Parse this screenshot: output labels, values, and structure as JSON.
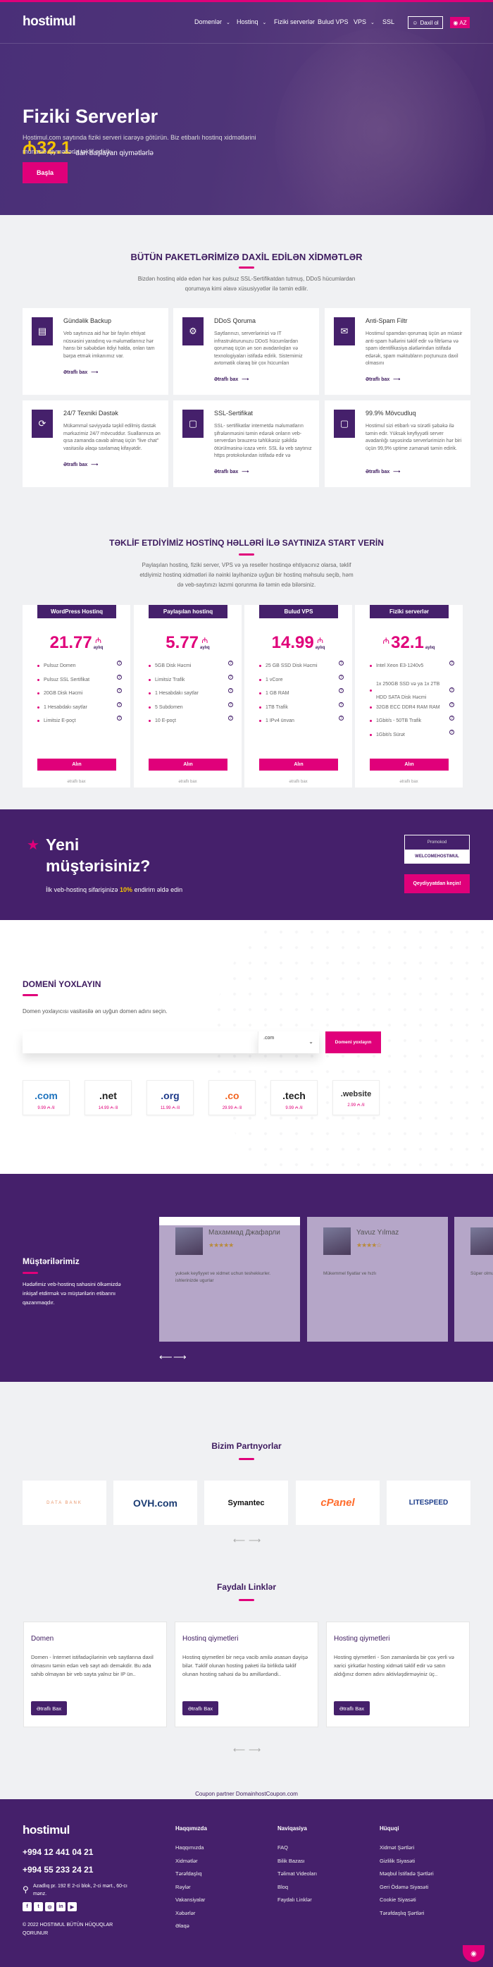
{
  "colors": {
    "purple": "#45206b",
    "pink": "#e0007a",
    "yellow": "#f5c400",
    "title": "#3d1a5e",
    "bg": "#f0f1f3"
  },
  "header": {
    "logo": "hostimul",
    "nav": [
      {
        "label": "Domenlər",
        "dropdown": true
      },
      {
        "label": "Hostinq",
        "dropdown": true
      },
      {
        "label": "Fiziki serverlər",
        "dropdown": false
      },
      {
        "label": "Bulud VPS",
        "dropdown": false
      },
      {
        "label": "VPS",
        "dropdown": true
      },
      {
        "label": "SSL",
        "dropdown": false
      }
    ],
    "login_label": "Daxil ol",
    "lang_label": "AZ"
  },
  "hero": {
    "title": "Fiziki Serverlər",
    "currency": "₼",
    "price": "32.1",
    "price_suffix": "-dan başlayan qiymətlərlə",
    "description": "Hostimul.com saytında fiziki serveri icarəyə götürün. Biz etibarlı hostinq xidmətlərini münasib qiymətlərlə təklif edirik.",
    "cta": "Başla"
  },
  "features": {
    "title": "BÜTÜN PAKETLƏRİMİZƏ DAXİL EDİLƏN XİDMƏTLƏR",
    "subtitle": "Bizdən hostinq əldə edən hər kəs pulsuz SSL-Sertifikatdan tutmuş, DDoS hücumlardan qorumaya kimi əlavə xüsusiyyətlər ilə təmin edilir.",
    "link_label": "Ətraflı bax",
    "items": [
      {
        "icon": "backup-icon",
        "title": "Gündəlik Backup",
        "text": "Veb saytınıza aid hər bir faylın ehtiyat nüsxəsini yaradırıq və məlumatlarınız hər hansı bir səbəbdən itdiyi halda, onları tam bərpa etmək imkanımız var."
      },
      {
        "icon": "ddos-shield-icon",
        "title": "DDoS Qoruma",
        "text": "Saytlarınızı, serverlərinizi və IT infrastrukturunuzu DDoS hücumlardan qorumaq üçün ən son avadanlıqları və texnologiyaları istifadə edirik. Sistemimiz avtomatik olaraq bir çox hücumları"
      },
      {
        "icon": "spam-mail-icon",
        "title": "Anti-Spam Filtr",
        "text": "Hostimul spamdan qorumaq üçün ən müasir anti-spam həllərini təklif edir və filtrləmə və spam identifikasiya alətlərindən istifadə edərək, spam məktubların poçtunuza daxil olmasını"
      },
      {
        "icon": "support-24-icon",
        "title": "24/7 Texniki Dəstək",
        "text": "Mükəmməl səviyyədə təşkil edilmiş dəstək mərkəzimiz 24/7 mövcuddur. Suallarınıza ən qısa zamanda cavab almaq üçün \"live chat\" vasitəsilə əlaqə saxlamaq kifayətdir."
      },
      {
        "icon": "ssl-icon",
        "title": "SSL-Sertifikat",
        "text": "SSL- sertifikatlar internetdə məlumatların şifrələnməsini təmin edərək onların veb-serverdən brauzerə təhlükəsiz şəkildə ötürülməsinə icazə verir. SSL ilə veb saytınız https protokolundan istifadə edir və"
      },
      {
        "icon": "uptime-icon",
        "title": "99.9% Mövcudluq",
        "text": "Hostimul sizi etibarlı və sürətli şəbəkə ilə təmin edir. Yüksək keyfiyyətli server avadanlığı sayəsində serverlərimizin hər biri üçün 99,9% uptime zəmanəti təmin edirik."
      }
    ]
  },
  "pricing": {
    "title": "TƏKLİF ETDİYİMİZ HOSTİNQ HƏLLƏRİ İLƏ SAYTINIZA START VERİN",
    "subtitle": "Paylaşılan hostinq, fiziki server, VPS və ya reseller hostinqə ehtiyacınız olarsa, təklif etdiyimiz hostinq xidmətləri ilə nəinki layihənizə uyğun bir hostinq məhsulu seçib, həm də veb-saytınızı lazımi qorunma ilə təmin edə bilərsiniz.",
    "currency": "₼",
    "period": "aylıq",
    "buy_label": "Alın",
    "more_label": "ətraflı bax",
    "plans": [
      {
        "name": "WordPress Hostinq",
        "price": "21.77",
        "features": [
          "Pulsuz Domen",
          "Pulsuz SSL Sertifikat",
          "20GB Disk Həcmi",
          "1 Hesabdakı saytlar",
          "Limitsiz E-poçt"
        ]
      },
      {
        "name": "Paylaşılan hostinq",
        "price": "5.77",
        "features": [
          "5GB Disk Həcmi",
          "Limitsiz Trafik",
          "1 Hesabdakı saytlar",
          "5 Subdomen",
          "10 E-poçt"
        ]
      },
      {
        "name": "Bulud VPS",
        "price": "14.99",
        "features": [
          "25 GB SSD Disk Həcmi",
          "1 vCore",
          "1 GB RAM",
          "1TB Trafik",
          "1 IPv4 ünvan"
        ]
      },
      {
        "name": "Fiziki serverlər",
        "price": "32.1",
        "features": [
          "Intel Xeon E3-1240v5",
          "1x 250GB SSD və ya 1x 2TB HDD SATA Disk Həcmi",
          "32GB ECC DDR4 RAM RAM",
          "1Gbit/s - 50TB Trafik",
          "1Gbit/s Sürət"
        ]
      }
    ]
  },
  "promo": {
    "title_line1": "Yeni",
    "title_line2": "müştərisiniz?",
    "text_before": "İlk veb-hostinq sifarişinizə ",
    "discount": "10%",
    "text_after": " endirim əldə edin",
    "code_label": "Promokod",
    "code": "WELCOMEHOSTIMUL",
    "cta": "Qeydiyyatdan keçin!"
  },
  "domain": {
    "title": "DOMENİ YOXLAYIN",
    "description": "Domen yoxlayıcısı vasitəsilə ən uyğun domen adını seçin.",
    "input_value": "",
    "input_placeholder": "",
    "selected_tld": ".com",
    "button": "Domeni yoxlayın",
    "tlds": [
      {
        "name": ".com",
        "price": "9.99 ₼ /il",
        "color": "#1e73be"
      },
      {
        "name": ".net",
        "price": "14.99 ₼ /il",
        "color": "#222222"
      },
      {
        "name": ".org",
        "price": "11.99 ₼ /il",
        "color": "#1e3a8a"
      },
      {
        "name": ".co",
        "price": "29.99 ₼ /il",
        "color": "#f26522"
      },
      {
        "name": ".tech",
        "price": "9.99 ₼ /il",
        "color": "#222222"
      },
      {
        "name": ".website",
        "price": "2.99 ₼ /il",
        "color": "#333333"
      }
    ]
  },
  "testimonials": {
    "title": "Müştərilərimiz",
    "text": "Hədəfimiz veb-hostinq sahəsini ölkəmizdə inkişaf etdirmək və müştərilərin etibarını qazanmaqdır.",
    "items": [
      {
        "name": "Махаммад Джафарли",
        "rating": 5,
        "stars": "★★★★★",
        "comment": "yuksek keyfiyyet ve xidmet uchun teshekkurler. ishlerinizde ugurlar"
      },
      {
        "name": "Yavuz Yılmaz",
        "rating": 4,
        "stars": "★★★★☆",
        "comment": "Mükemmel fiyatlar ve hızlı"
      },
      {
        "name": "",
        "rating": 0,
        "stars": "",
        "comment": "Süper olmu"
      }
    ]
  },
  "partners": {
    "title": "Bizim Partnyorlar",
    "items": [
      {
        "name": "DATA BANK",
        "color": "#e8956a"
      },
      {
        "name": "OVH.com",
        "color": "#1b3c73"
      },
      {
        "name": "Symantec",
        "color": "#111111"
      },
      {
        "name": "cPanel",
        "color": "#ff6c2c"
      },
      {
        "name": "LITESPEED",
        "color": "#1b3c8a"
      }
    ]
  },
  "links": {
    "title": "Faydalı Linklər",
    "button": "Ətraflı Bax",
    "items": [
      {
        "title": "Domen",
        "text": "Domen - İnternet istifadəçilərinin veb saytlarına daxil olmasını təmin edən veb sayt adı deməkdir. Bu ada sahib olmayan bir veb sayta yalnız bir IP ün.."
      },
      {
        "title": "Hostinq qiymetleri",
        "text": "Hostinq qiymetleri bir neçə vacib amilə əsasən dəyişə bilər. Təklif olunan hosting paketi ilə birlikdə təklif olunan hosting sahəsi də bu amillərdəndi.."
      },
      {
        "title": "Hosting qiymetleri",
        "text": "Hosting qiymetleri - Son zamanlarda bir çox yerli və xarici şirkətlər hosting xidməti təklif edir və satın aldığınız domen adını aktivləşdirməyiniz üç.."
      }
    ],
    "coupon": "Coupon partner DomainhostCoupon.com"
  },
  "footer": {
    "logo": "hostimul",
    "phones": [
      "+994 12 441 04 21",
      "+994 55 233 24 21"
    ],
    "address": "Azadlıq pr. 192 E 2-ci blok, 2-ci mərt., 60-cı mənz.",
    "socials": [
      "facebook-icon",
      "twitter-icon",
      "instagram-icon",
      "linkedin-icon",
      "youtube-icon"
    ],
    "copyright": "© 2022 HOSTIMUL BÜTÜN HÜQUQLAR QORUNUR",
    "columns": [
      {
        "title": "Haqqımızda",
        "items": [
          "Haqqımızda",
          "Xidmətlər",
          "Tərəfdaşlıq",
          "Rəylər",
          "Vakansiyalar",
          "Xəbərlər",
          "Əlaqə"
        ]
      },
      {
        "title": "Naviqasiya",
        "items": [
          "FAQ",
          "Bilik Bazası",
          "Təlimat Videoları",
          "Bloq",
          "Faydalı Linklər"
        ]
      },
      {
        "title": "Hüquqi",
        "items": [
          "Xidmət Şərtləri",
          "Gizlilik Siyasəti",
          "Məqbul İstifadə Şərtləri",
          "Geri Ödəmə Siyasəti",
          "Cookie Siyasəti",
          "Tərəfdaşlıq Şərtləri"
        ]
      }
    ]
  }
}
